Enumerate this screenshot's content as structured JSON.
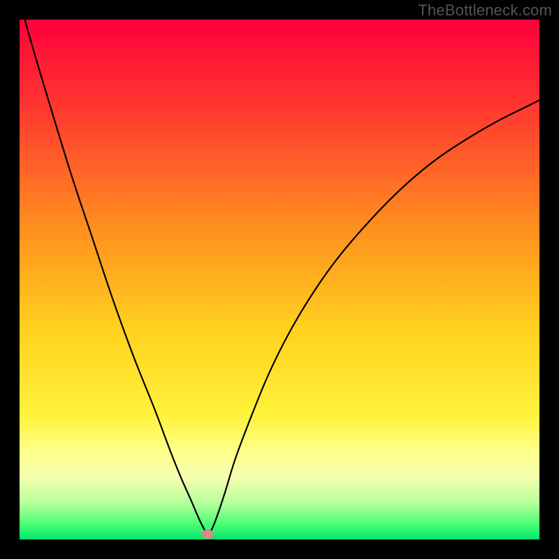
{
  "watermark": "TheBottleneck.com",
  "chart_data": {
    "type": "line",
    "title": "",
    "xlabel": "",
    "ylabel": "",
    "xlim": [
      0,
      1
    ],
    "ylim": [
      0,
      1
    ],
    "gradient_stops": [
      {
        "offset": 0.0,
        "color": "#ff003a"
      },
      {
        "offset": 0.18,
        "color": "#ff3b2f"
      },
      {
        "offset": 0.4,
        "color": "#ff8f1f"
      },
      {
        "offset": 0.6,
        "color": "#ffd21f"
      },
      {
        "offset": 0.76,
        "color": "#fff23a"
      },
      {
        "offset": 0.83,
        "color": "#ffff8a"
      },
      {
        "offset": 0.88,
        "color": "#f6ffb0"
      },
      {
        "offset": 0.93,
        "color": "#b6ff9a"
      },
      {
        "offset": 0.97,
        "color": "#4cff76"
      },
      {
        "offset": 1.0,
        "color": "#00e86a"
      }
    ],
    "series": [
      {
        "name": "bottleneck-curve",
        "x": [
          0.01,
          0.03,
          0.06,
          0.1,
          0.14,
          0.18,
          0.22,
          0.26,
          0.29,
          0.31,
          0.33,
          0.345,
          0.355,
          0.362,
          0.37,
          0.38,
          0.395,
          0.415,
          0.445,
          0.48,
          0.52,
          0.565,
          0.615,
          0.68,
          0.74,
          0.8,
          0.86,
          0.92,
          0.98,
          1.0
        ],
        "y": [
          1.0,
          0.93,
          0.83,
          0.7,
          0.58,
          0.46,
          0.35,
          0.25,
          0.17,
          0.12,
          0.075,
          0.04,
          0.02,
          0.01,
          0.02,
          0.045,
          0.09,
          0.155,
          0.235,
          0.32,
          0.4,
          0.475,
          0.545,
          0.62,
          0.68,
          0.73,
          0.77,
          0.805,
          0.835,
          0.845
        ]
      }
    ],
    "marker": {
      "x": 0.362,
      "y": 0.01,
      "rx": 0.012,
      "ry": 0.009,
      "color": "#d28b88"
    }
  }
}
